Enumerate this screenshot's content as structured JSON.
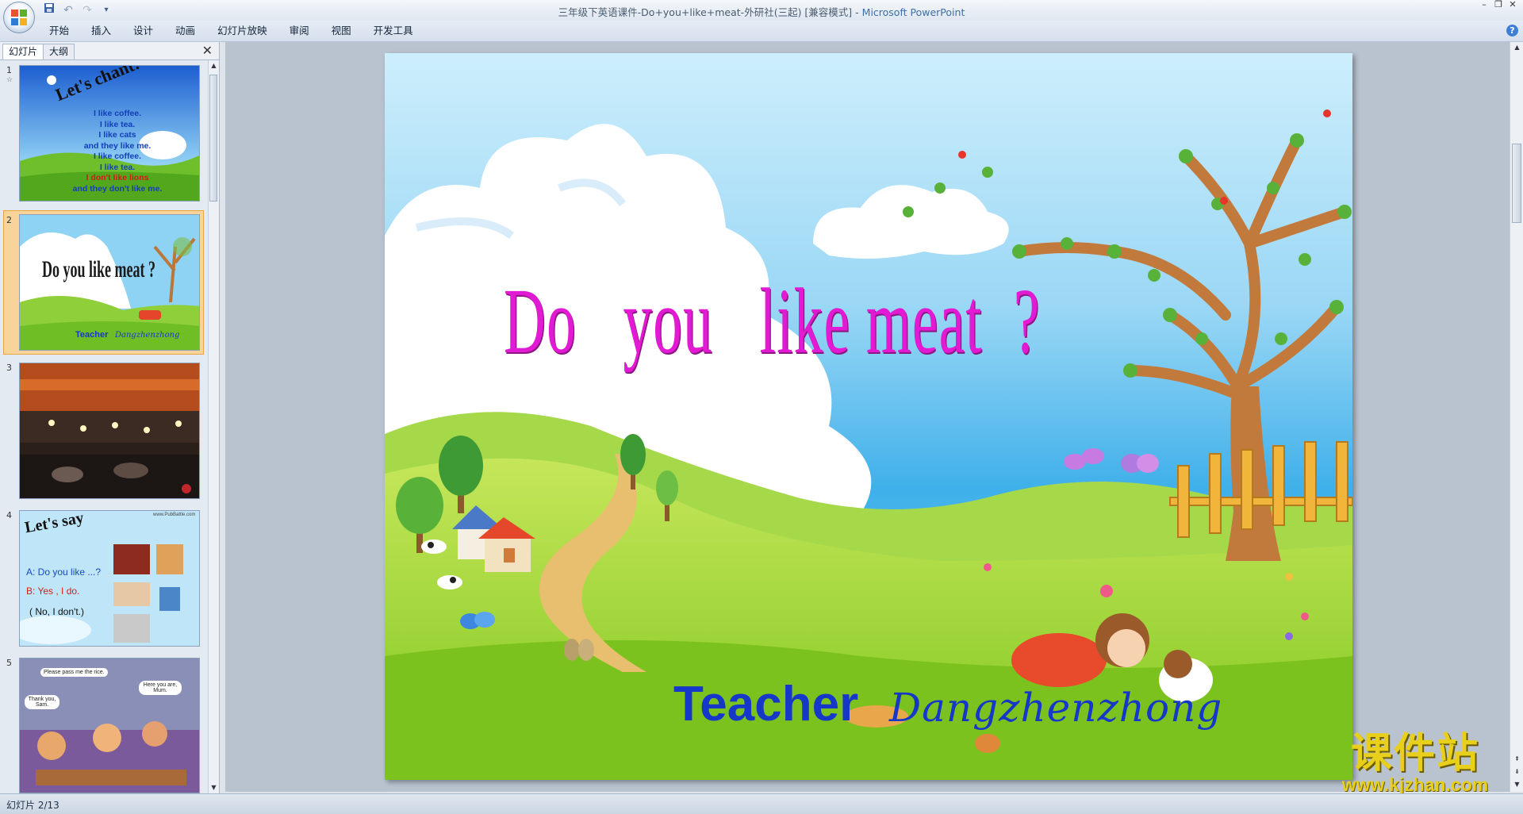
{
  "window": {
    "title": "三年级下英语课件-Do+you+like+meat-外研社(三起) [兼容模式]",
    "separator": " - ",
    "app": "Microsoft PowerPoint"
  },
  "ribbon": {
    "tabs": [
      "开始",
      "插入",
      "设计",
      "动画",
      "幻灯片放映",
      "审阅",
      "视图",
      "开发工具"
    ]
  },
  "left_panel": {
    "tabs": [
      "幻灯片",
      "大纲"
    ],
    "slides": [
      {
        "number": "1",
        "title": "Let's chant!",
        "lines": [
          "I like coffee.",
          "I like tea.",
          "I like cats",
          "and they like me.",
          "I like coffee.",
          "I like tea.",
          "I don't like lions",
          "and they don't like me."
        ]
      },
      {
        "number": "2",
        "title": "Do you like meat ?",
        "teacher": "Teacher",
        "name": "Dangzhenzhong"
      },
      {
        "number": "3"
      },
      {
        "number": "4",
        "title": "Let's say",
        "lines": [
          "A: Do you like ...?",
          "B: Yes , I do.",
          "( No, I don't.)"
        ],
        "site": "www.PubBattle.com"
      },
      {
        "number": "5",
        "bubbles": [
          "Please pass me the rice.",
          "Here you are, Mum.",
          "Thank you, Sam."
        ]
      }
    ]
  },
  "slide": {
    "title": "Do   you   like meat  ?",
    "teacher": "Teacher",
    "teacher_name": "Dangzhenzhong"
  },
  "watermark": {
    "brand": "课件站",
    "url": "www.kjzhan.com"
  },
  "status": {
    "text": "幻灯片 2/13"
  },
  "colors": {
    "title_magenta": "#e21ad3",
    "teacher_blue": "#1638c8",
    "selection_orange": "#f8d49b"
  }
}
